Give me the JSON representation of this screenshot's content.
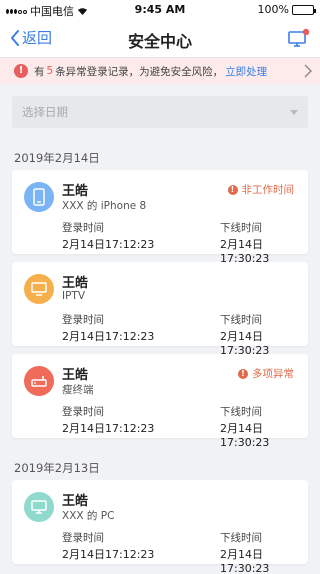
{
  "status": {
    "carrier": "中国电信",
    "time": "9:45 AM",
    "battery": "100%"
  },
  "nav": {
    "back_label": "返回",
    "title": "安全中心"
  },
  "warning": {
    "prefix": "有",
    "count": "5",
    "middle": "条异常登录记录，为避免安全风险，",
    "link": "立即处理"
  },
  "date_filter": {
    "placeholder": "选择日期"
  },
  "labels": {
    "login": "登录时间",
    "logout": "下线时间"
  },
  "sections": [
    {
      "date": "2019年2月14日",
      "records": [
        {
          "name": "王皓",
          "device": "XXX 的 iPhone 8",
          "icon": "phone-icon",
          "avatar_color": "#7ab4f5",
          "tag": "非工作时间",
          "login": "2月14日17:12:23",
          "logout": "2月14日17:30:23"
        },
        {
          "name": "王皓",
          "device": "IPTV",
          "icon": "tv-icon",
          "avatar_color": "#f5b04d",
          "tag": "",
          "login": "2月14日17:12:23",
          "logout": "2月14日17:30:23"
        },
        {
          "name": "王皓",
          "device": "瘦终端",
          "icon": "router-icon",
          "avatar_color": "#ef6b5a",
          "tag": "多项异常",
          "login": "2月14日17:12:23",
          "logout": "2月14日17:30:23"
        }
      ]
    },
    {
      "date": "2019年2月13日",
      "records": [
        {
          "name": "王皓",
          "device": "XXX 的 PC",
          "icon": "monitor-icon",
          "avatar_color": "#8fd9cd",
          "tag": "",
          "login": "2月14日17:12:23",
          "logout": "2月14日17:30:23"
        }
      ]
    }
  ],
  "colors": {
    "accent": "#3a7ee8",
    "danger": "#e85d5d"
  }
}
